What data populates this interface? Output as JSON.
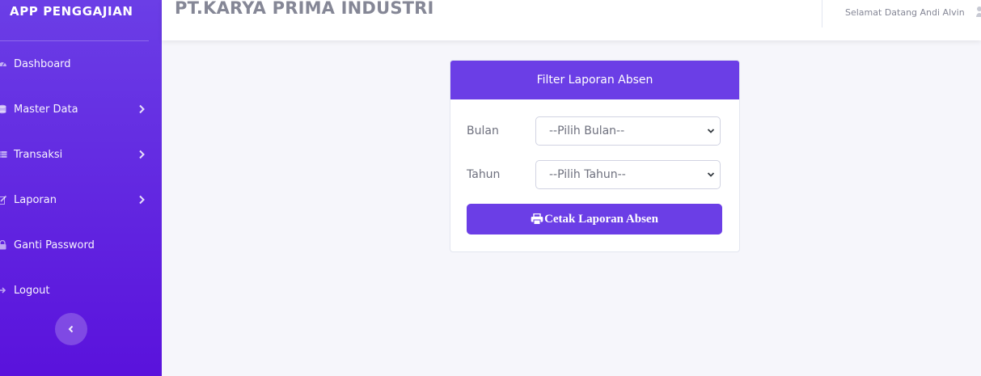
{
  "sidebar": {
    "brand": "APP PENGGAJIAN",
    "items": [
      {
        "label": "Dashboard",
        "icon": "dashboard-icon",
        "has_submenu": false
      },
      {
        "label": "Master Data",
        "icon": "database-icon",
        "has_submenu": true
      },
      {
        "label": "Transaksi",
        "icon": "table-icon",
        "has_submenu": true
      },
      {
        "label": "Laporan",
        "icon": "pencil-icon",
        "has_submenu": true
      },
      {
        "label": "Ganti Password",
        "icon": "lock-icon",
        "has_submenu": false
      },
      {
        "label": "Logout",
        "icon": "sign-out-icon",
        "has_submenu": false
      }
    ],
    "collapse_icon": "chevron-left-icon"
  },
  "topbar": {
    "company": "PT.KARYA PRIMA INDUSTRI",
    "welcome": "Selamat Datang Andi Alvin",
    "user_icon": "user-icon"
  },
  "filter_card": {
    "title": "Filter Laporan Absen",
    "month_label": "Bulan",
    "month_value": "--Pilih Bulan--",
    "year_label": "Tahun",
    "year_value": "--Pilih Tahun--",
    "submit_label": "Cetak Laporan Absen",
    "submit_icon": "print-icon"
  },
  "colors": {
    "primary": "#6b3ee6",
    "sidebar_bottom": "#5a12dc",
    "background": "#f6f6fb",
    "muted_text": "#858796"
  }
}
